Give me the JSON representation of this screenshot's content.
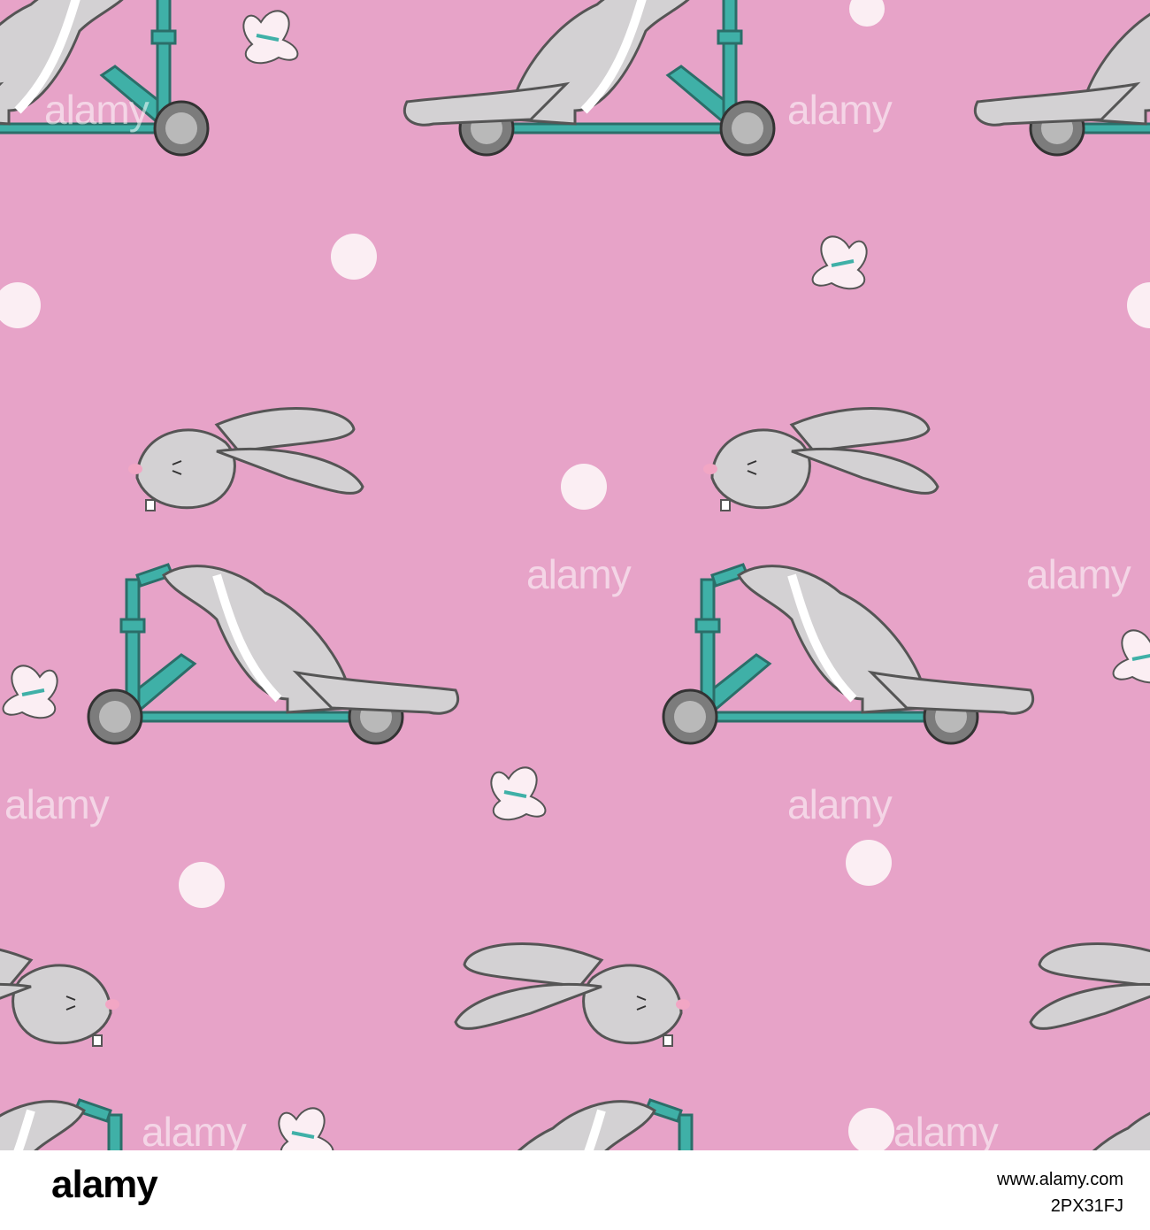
{
  "pattern": {
    "background_color": "#e7a3c8",
    "scooter_color": "#3fb0a7",
    "bunny_color": "#d3d1d3",
    "dot_color": "#fbeef3",
    "watermark_text": "alamy"
  },
  "footer": {
    "logo_text": "alamy",
    "image_id": "2PX31FJ",
    "site": "www.alamy.com"
  }
}
